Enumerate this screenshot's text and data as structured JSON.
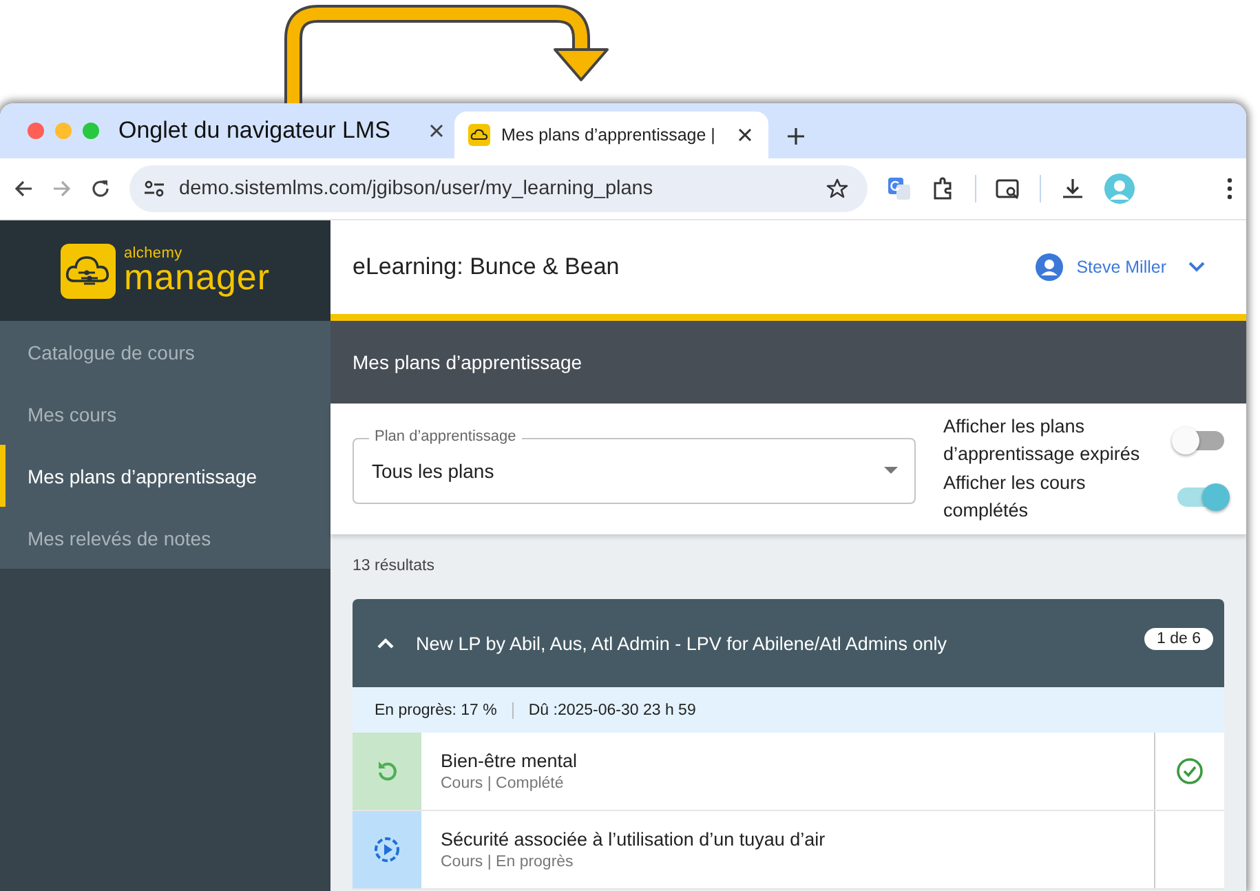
{
  "browser": {
    "tabs": [
      {
        "title": "Onglet du navigateur LMS",
        "selected": false
      },
      {
        "title": "Mes plans d’apprentissage |",
        "selected": true
      }
    ],
    "address": "demo.sistemlms.com/jgibson/user/my_learning_plans"
  },
  "app": {
    "logo": {
      "small": "alchemy",
      "big": "manager"
    },
    "nav": [
      {
        "label": "Catalogue de cours",
        "selected": false
      },
      {
        "label": "Mes cours",
        "selected": false
      },
      {
        "label": "Mes plans d’apprentissage",
        "selected": true
      },
      {
        "label": "Mes relevés de notes",
        "selected": false
      }
    ],
    "header_title": "eLearning: Bunce & Bean",
    "user": "Steve Miller",
    "page_title": "Mes plans d’apprentissage",
    "filter": {
      "label": "Plan d’apprentissage",
      "value": "Tous les plans"
    },
    "toggles": [
      {
        "label": "Afficher les plans d’apprentissage expirés",
        "on": false
      },
      {
        "label": "Afficher les cours complétés",
        "on": true
      }
    ],
    "results": "13 résultats",
    "plan": {
      "title": "New LP by Abil, Aus, Atl Admin - LPV for Abilene/Atl Admins only",
      "expanded": true,
      "badge": "1 de 6",
      "progress": "En progrès: 17 %",
      "due": "Dû :2025-06-30 23 h 59",
      "courses": [
        {
          "title": "Bien-être mental",
          "meta": "Cours | Complété",
          "kind": "completed"
        },
        {
          "title": "Sécurité associée à l’utilisation d’un tuyau d’air",
          "meta": "Cours | En progrès",
          "kind": "in_progress"
        }
      ]
    }
  }
}
